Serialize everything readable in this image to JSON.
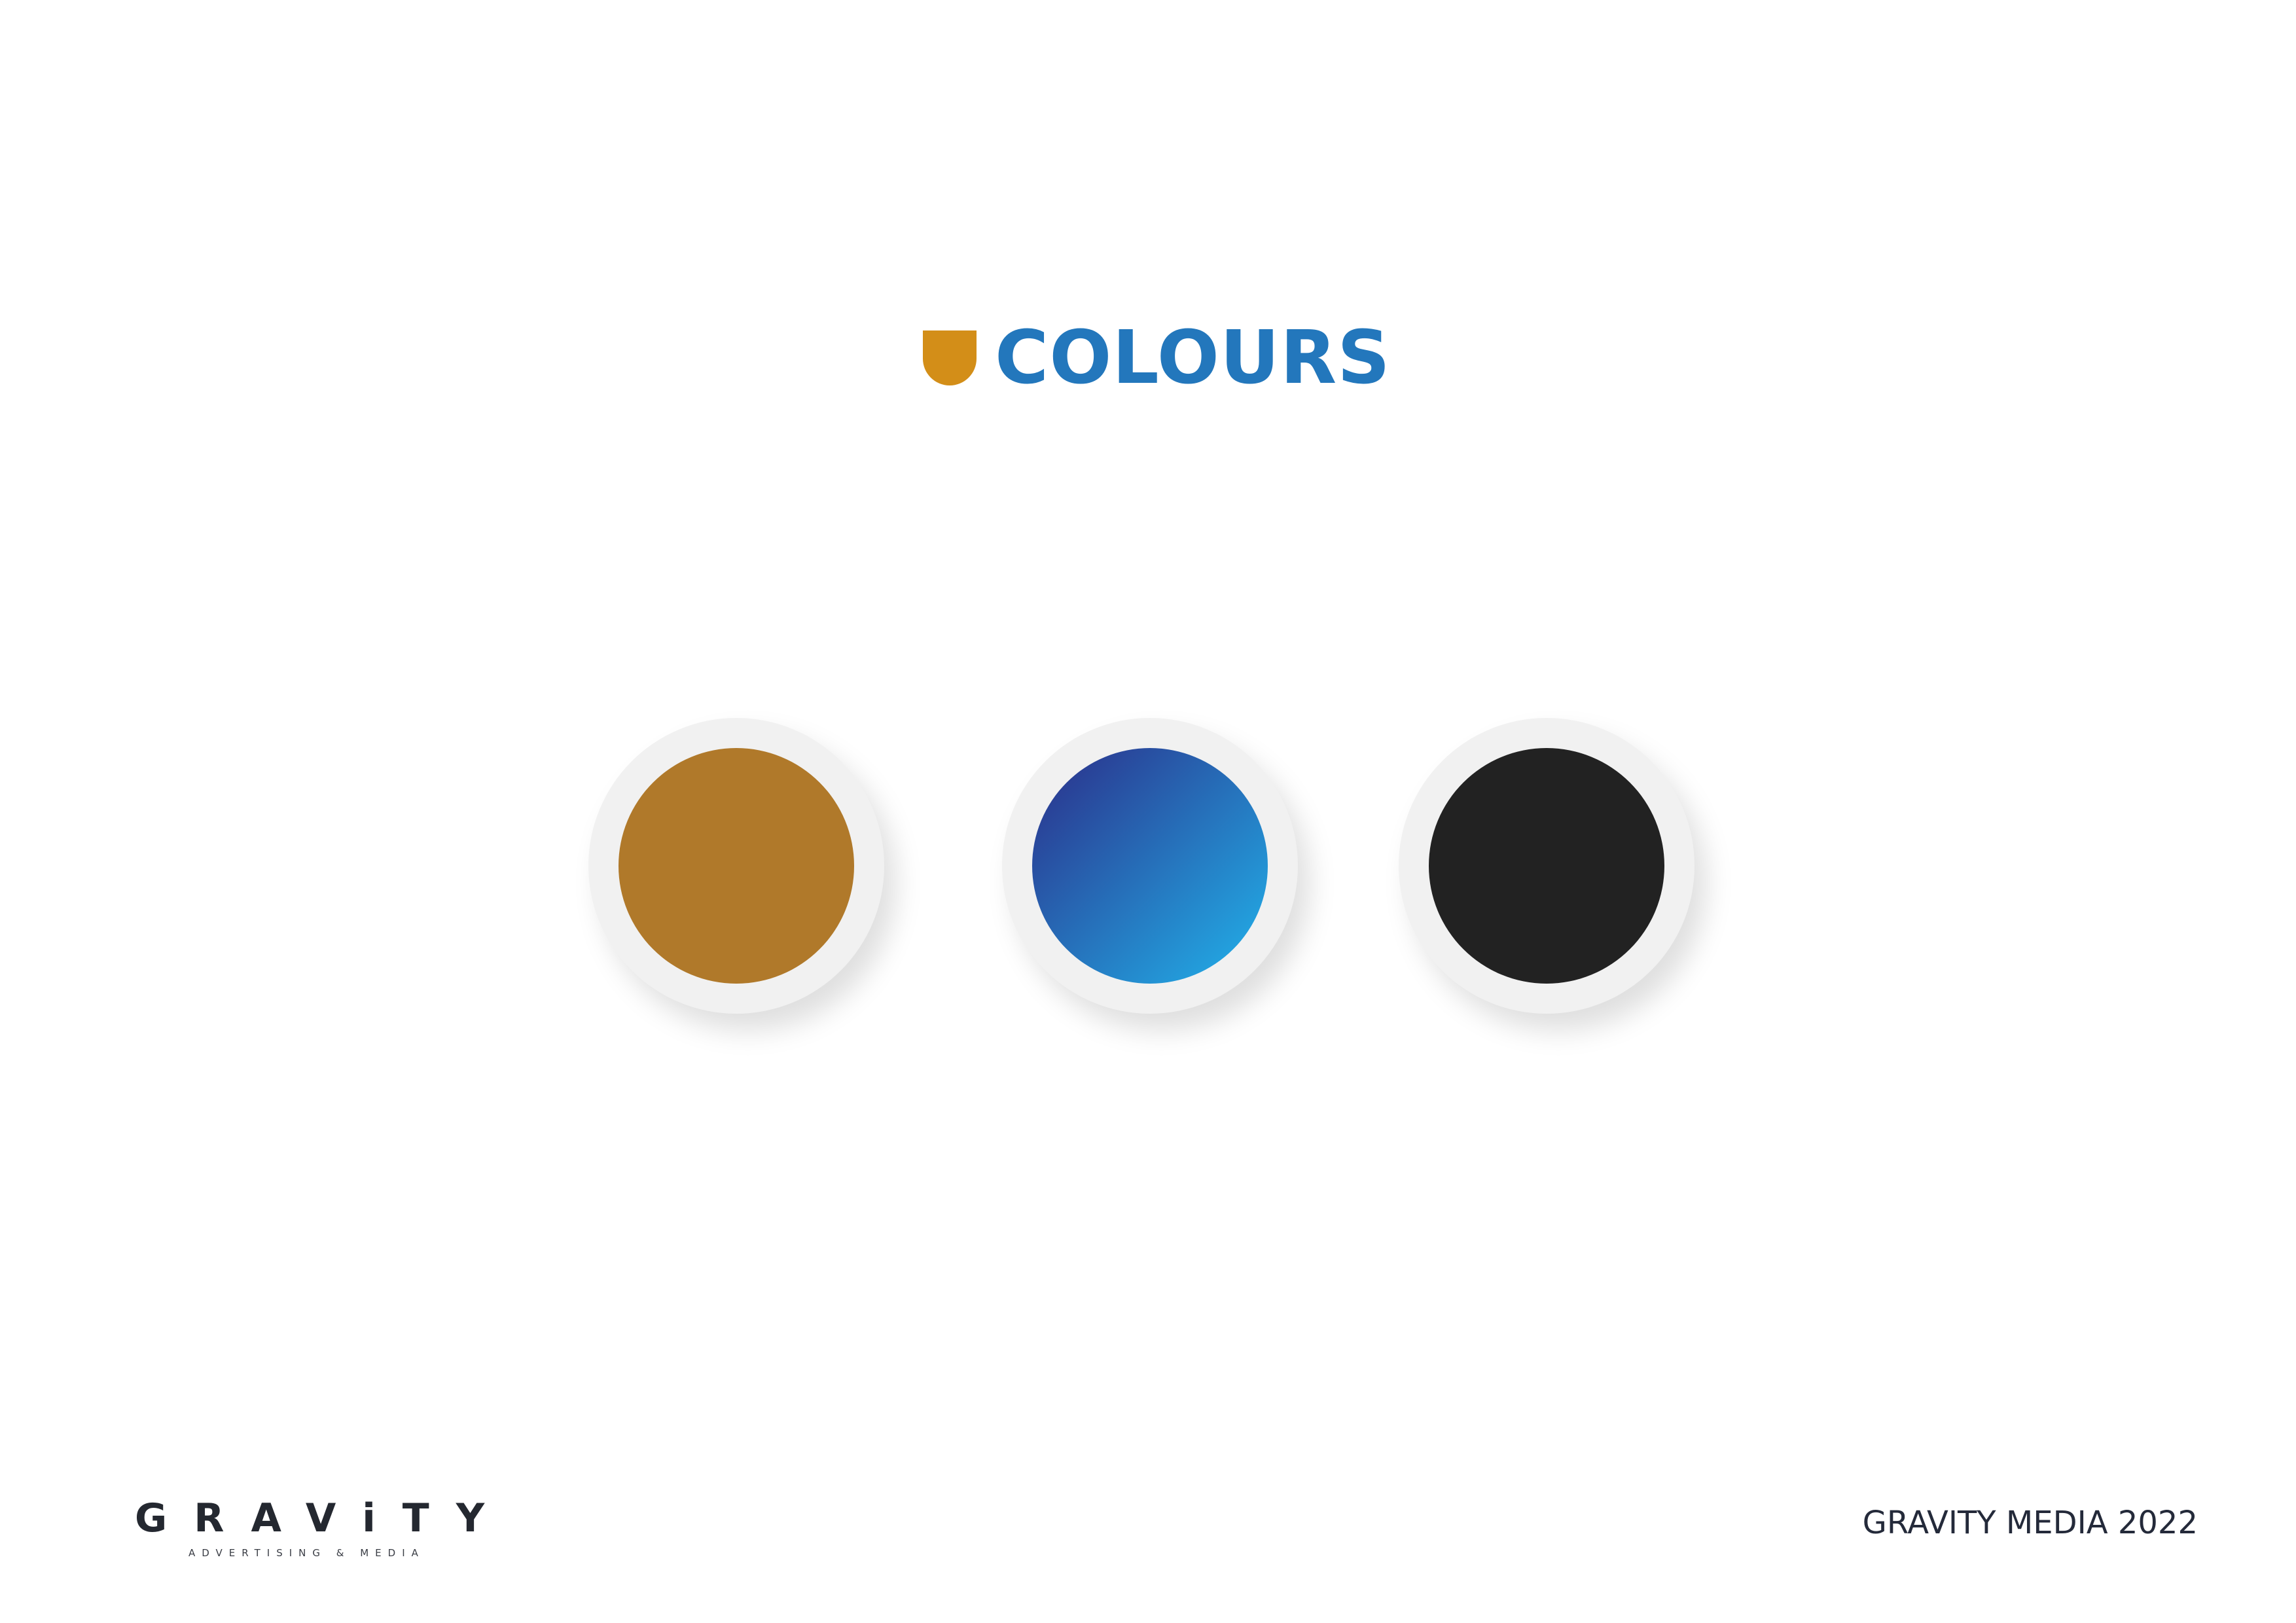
{
  "header": {
    "title": "COLOURS",
    "title_color": "#2377BC",
    "mark_color": "#D38E18"
  },
  "swatches": [
    {
      "name": "gold",
      "color": "#B0792A"
    },
    {
      "name": "blue-gradient",
      "gradient_start": "#2A3A92",
      "gradient_end": "#22A9E4"
    },
    {
      "name": "black",
      "color": "#222222"
    }
  ],
  "footer": {
    "logo_word": "GRAViTY",
    "logo_tagline": "ADVERTISING & MEDIA",
    "text": "GRAVITY MEDIA 2022"
  }
}
